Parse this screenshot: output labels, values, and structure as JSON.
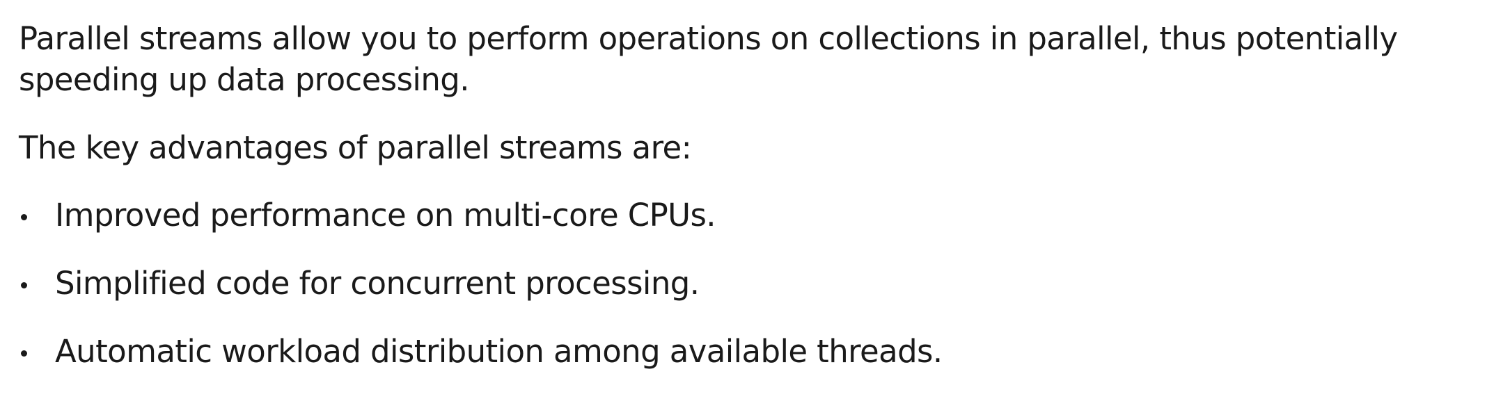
{
  "intro": {
    "line1": "Parallel streams allow you to perform operations on collections in parallel, thus potentially",
    "line2": "speeding up data processing."
  },
  "lead": "The key advantages of parallel streams are:",
  "advantages": [
    "Improved performance on multi-core CPUs.",
    "Simplified code for concurrent processing.",
    "Automatic workload distribution among available threads."
  ]
}
